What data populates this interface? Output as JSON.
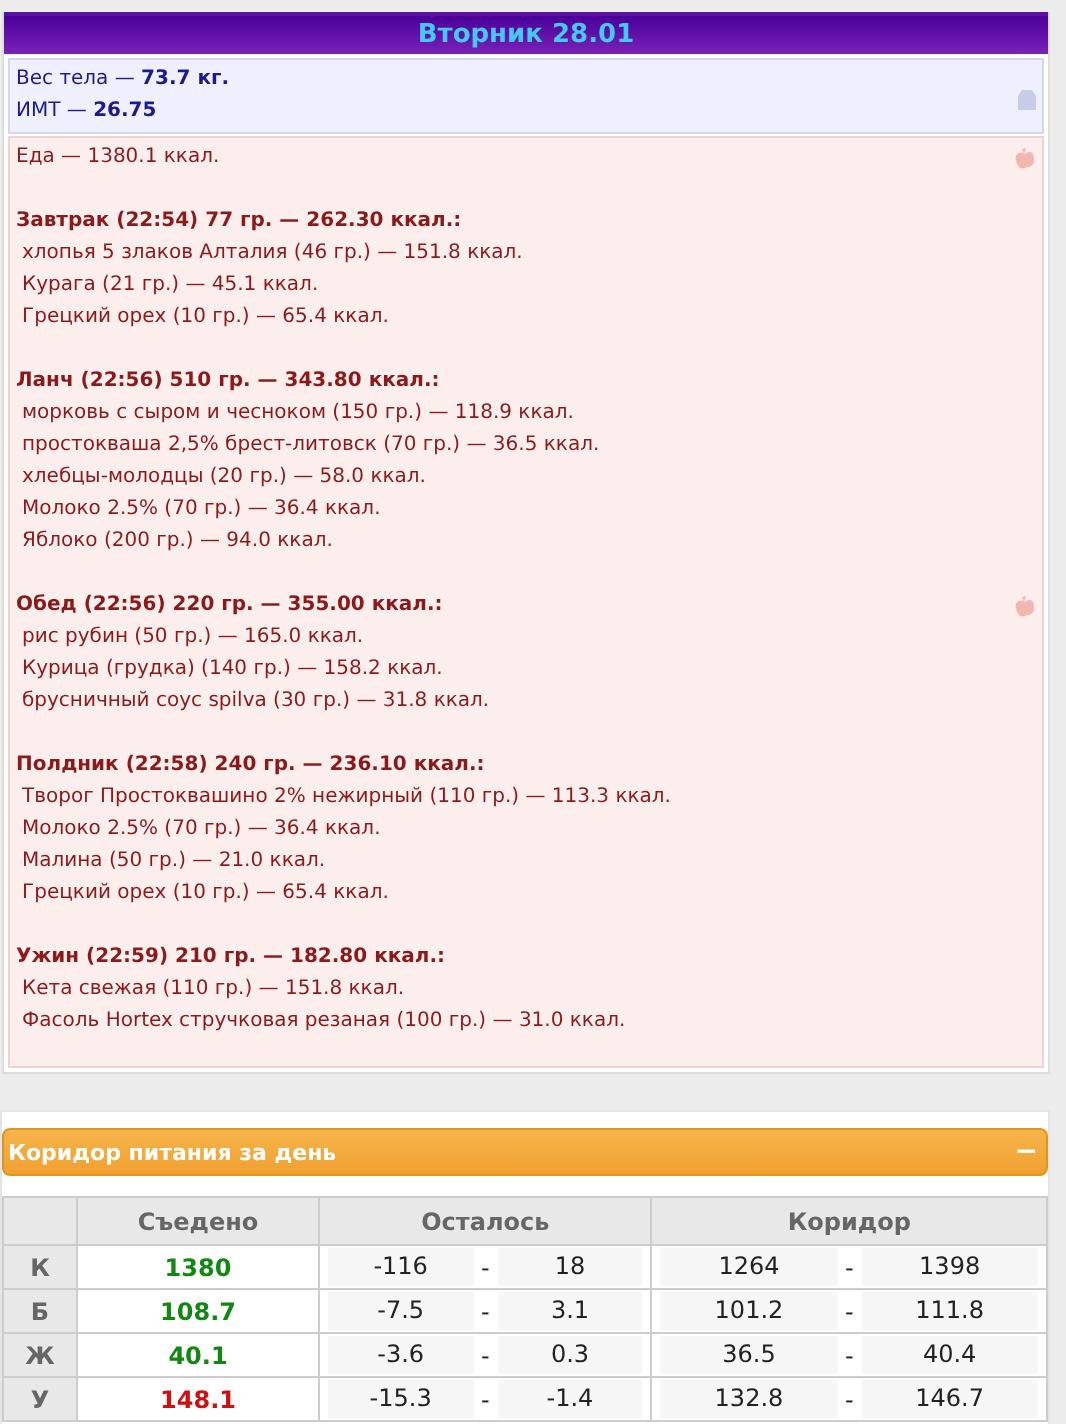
{
  "day_title": "Вторник 28.01",
  "body": {
    "weight": "Вес тела — **73.7 кг.**",
    "bmi": "ИМТ — **26.75**"
  },
  "food": {
    "total": "Еда — 1380.1 ккал.",
    "meals": [
      {
        "header": "Завтрак (22:54) 77 гр. — 262.30 ккал.:",
        "marked": false,
        "items": [
          "хлопья 5 злаков Алталия (46 гр.) — 151.8 ккал.",
          "Курага (21 гр.) — 45.1 ккал.",
          "Грецкий орех (10 гр.) — 65.4 ккал."
        ]
      },
      {
        "header": "Ланч (22:56) 510 гр. — 343.80 ккал.:",
        "marked": false,
        "items": [
          "морковь с сыром и чесноком (150 гр.) — 118.9 ккал.",
          "простокваша 2,5% брест-литовск (70 гр.) — 36.5 ккал.",
          "хлебцы-молодцы (20 гр.) — 58.0 ккал.",
          "Молоко 2.5% (70 гр.) — 36.4 ккал.",
          "Яблоко (200 гр.) — 94.0 ккал."
        ]
      },
      {
        "header": "Обед (22:56) 220 гр. — 355.00 ккал.:",
        "marked": true,
        "items": [
          "рис рубин (50 гр.) — 165.0 ккал.",
          "Курица (грудка) (140 гр.) — 158.2 ккал.",
          "брусничный соус spilva (30 гр.) — 31.8 ккал."
        ]
      },
      {
        "header": "Полдник (22:58) 240 гр. — 236.10 ккал.:",
        "marked": false,
        "items": [
          "Творог Простоквашино 2% нежирный (110 гр.) — 113.3 ккал.",
          "Молоко 2.5% (70 гр.) — 36.4 ккал.",
          "Малина (50 гр.) — 21.0 ккал.",
          "Грецкий орех (10 гр.) — 65.4 ккал."
        ]
      },
      {
        "header": "Ужин (22:59) 210 гр. — 182.80 ккал.:",
        "marked": false,
        "items": [
          "Кета свежая (110 гр.) — 151.8 ккал.",
          "Фасоль Hortex стручковая резаная (100 гр.) — 31.0 ккал."
        ]
      }
    ]
  },
  "corridor": {
    "title": "Коридор питания за день",
    "collapse": "−",
    "columns": [
      "Съедено",
      "Осталось",
      "Коридор"
    ],
    "rows": [
      {
        "label": "К",
        "eaten": "1380",
        "color": "#118811",
        "remaining": [
          "-116",
          "-",
          "18"
        ],
        "corridor": [
          "1264",
          "-",
          "1398"
        ]
      },
      {
        "label": "Б",
        "eaten": "108.7",
        "color": "#118811",
        "remaining": [
          "-7.5",
          "-",
          "3.1"
        ],
        "corridor": [
          "101.2",
          "-",
          "111.8"
        ]
      },
      {
        "label": "Ж",
        "eaten": "40.1",
        "color": "#118811",
        "remaining": [
          "-3.6",
          "-",
          "0.3"
        ],
        "corridor": [
          "36.5",
          "-",
          "40.4"
        ]
      },
      {
        "label": "У",
        "eaten": "148.1",
        "color": "#cc1111",
        "remaining": [
          "-15.3",
          "-",
          "-1.4"
        ],
        "corridor": [
          "132.8",
          "-",
          "146.7"
        ]
      }
    ]
  }
}
